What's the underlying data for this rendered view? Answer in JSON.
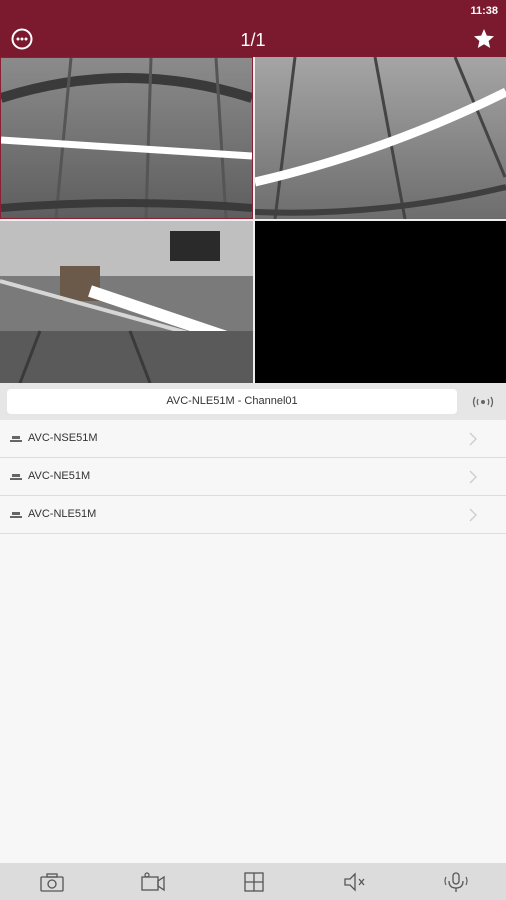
{
  "status_bar": {
    "time": "11:38"
  },
  "header": {
    "title": "1/1",
    "menu_icon": "more-horizontal-icon",
    "favorite_icon": "star-icon"
  },
  "video_grid": {
    "tiles": [
      {
        "state": "live"
      },
      {
        "state": "live"
      },
      {
        "state": "live"
      },
      {
        "state": "empty"
      }
    ]
  },
  "channel_bar": {
    "label": "AVC-NLE51M - Channel01",
    "ptz_icon": "ptz-icon"
  },
  "devices": [
    {
      "name": "AVC-NSE51M"
    },
    {
      "name": "AVC-NE51M"
    },
    {
      "name": "AVC-NLE51M"
    }
  ],
  "toolbar": {
    "buttons": [
      "snapshot-icon",
      "record-icon",
      "grid-layout-icon",
      "mute-icon",
      "talk-icon"
    ]
  },
  "colors": {
    "header": "#7b1a2e",
    "selected_tile_border": "#8a2035",
    "toolbar": "#dcdcdc"
  }
}
